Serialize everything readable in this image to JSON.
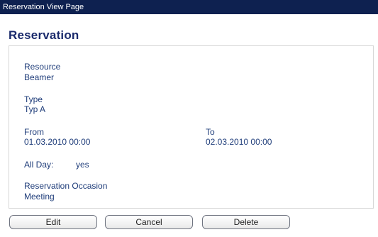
{
  "window": {
    "title": "Reservation View Page"
  },
  "page": {
    "title": "Reservation"
  },
  "reservation": {
    "resource_label": "Resource",
    "resource_value": "Beamer",
    "type_label": "Type",
    "type_value": "Typ A",
    "from_label": "From",
    "from_value": "01.03.2010 00:00",
    "to_label": "To",
    "to_value": "02.03.2010 00:00",
    "allday_label": "All Day:",
    "allday_value": "yes",
    "occasion_label": "Reservation Occasion",
    "occasion_value": "Meeting"
  },
  "actions": {
    "edit_label": "Edit",
    "cancel_label": "Cancel",
    "delete_label": "Delete"
  },
  "colors": {
    "titlebar_bg": "#0e2150",
    "heading": "#1a2a6c",
    "field_text": "#1f3d7a",
    "panel_border": "#d7d7d7"
  }
}
